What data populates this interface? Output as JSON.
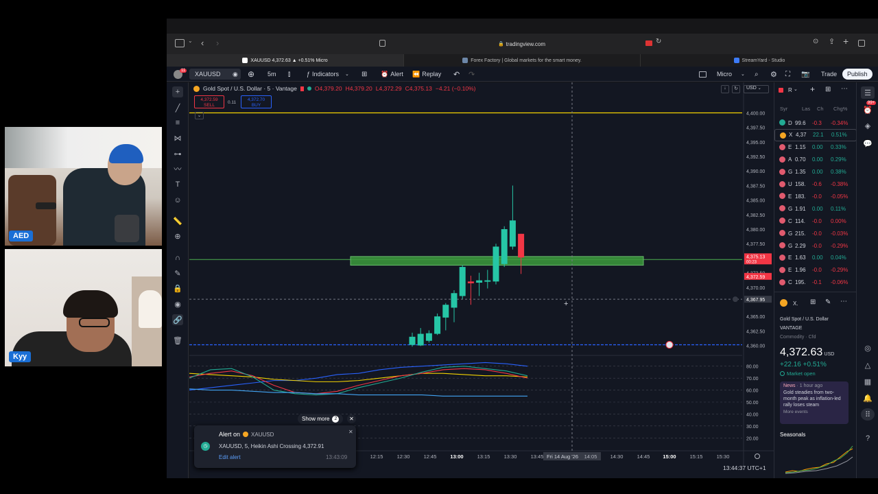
{
  "browser": {
    "url": "tradingview.com",
    "tabs": [
      {
        "label": "XAUUSD 4,372.63 ▲ +0.51% Micro",
        "active": true
      },
      {
        "label": "Forex Factory | Global markets for the smart money.",
        "active": false
      },
      {
        "label": "StreamYard - Studio",
        "active": false
      }
    ]
  },
  "toolbar": {
    "symbol": "XAUUSD",
    "notif_count": "11",
    "interval": "5m",
    "indicators": "Indicators",
    "alert": "Alert",
    "replay": "Replay",
    "layout_name": "Micro",
    "trade": "Trade",
    "publish": "Publish"
  },
  "legend": {
    "title": "Gold Spot / U.S. Dollar · 5 · Vantage",
    "o": "O4,379.20",
    "h": "H4,379.20",
    "l": "L4,372.29",
    "c": "C4,375.13",
    "chg": "−4.21 (−0.10%)",
    "sell_price": "4,372.59",
    "sell_label": "SELL",
    "spread": "0.11",
    "buy_price": "4,372.70",
    "buy_label": "BUY",
    "currency": "USD"
  },
  "chart_data": {
    "type": "candlestick",
    "symbol": "XAUUSD",
    "interval": "5",
    "price_ticks": [
      "4,400.00",
      "4,397.50",
      "4,395.00",
      "4,392.50",
      "4,390.00",
      "4,387.50",
      "4,385.00",
      "4,382.50",
      "4,380.00",
      "4,377.50",
      "4,375.00",
      "4,372.50",
      "4,370.00",
      "4,367.95",
      "4,365.00",
      "4,362.50",
      "4,360.00"
    ],
    "price_ylim": [
      4359,
      4401
    ],
    "time_ticks": [
      "12:15",
      "12:30",
      "12:45",
      "13:00",
      "13:15",
      "13:30",
      "13:45",
      "Fri 14 Aug '26",
      "14:05",
      "14:30",
      "14:45",
      "15:00",
      "15:15",
      "15:30"
    ],
    "candles": [
      {
        "o": 4360.1,
        "h": 4362.2,
        "l": 4359.8,
        "c": 4361.5,
        "dir": "up"
      },
      {
        "o": 4360.0,
        "h": 4363.0,
        "l": 4359.9,
        "c": 4362.0,
        "dir": "up"
      },
      {
        "o": 4360.8,
        "h": 4362.6,
        "l": 4360.5,
        "c": 4362.1,
        "dir": "up"
      },
      {
        "o": 4362.0,
        "h": 4365.5,
        "l": 4361.8,
        "c": 4365.0,
        "dir": "up"
      },
      {
        "o": 4364.8,
        "h": 4367.3,
        "l": 4362.6,
        "c": 4367.0,
        "dir": "up"
      },
      {
        "o": 4366.5,
        "h": 4369.5,
        "l": 4364.0,
        "c": 4369.0,
        "dir": "up"
      },
      {
        "o": 4368.5,
        "h": 4373.8,
        "l": 4368.0,
        "c": 4373.5,
        "dir": "up"
      },
      {
        "o": 4371.0,
        "h": 4372.0,
        "l": 4367.0,
        "c": 4370.7,
        "dir": "down"
      },
      {
        "o": 4370.8,
        "h": 4372.5,
        "l": 4368.5,
        "c": 4371.2,
        "dir": "up"
      },
      {
        "o": 4371.0,
        "h": 4373.0,
        "l": 4369.8,
        "c": 4371.2,
        "dir": "up"
      },
      {
        "o": 4371.0,
        "h": 4377.5,
        "l": 4370.5,
        "c": 4377.0,
        "dir": "up"
      },
      {
        "o": 4374.0,
        "h": 4380.5,
        "l": 4373.5,
        "c": 4380.0,
        "dir": "up"
      },
      {
        "o": 4377.0,
        "h": 4387.5,
        "l": 4376.5,
        "c": 4381.5,
        "dir": "up"
      },
      {
        "o": 4379.2,
        "h": 4379.2,
        "l": 4372.3,
        "c": 4375.13,
        "dir": "down"
      }
    ],
    "zone": {
      "top": 4375.3,
      "bottom": 4373.8
    },
    "levels": [
      {
        "name": "current price",
        "price": "4,375.13",
        "color": "#f23645",
        "countdown": "00:23"
      },
      {
        "name": "bid",
        "price": "4,372.59",
        "color": "#f23645"
      },
      {
        "name": "crosshair",
        "price": "4,367.95"
      },
      {
        "name": "alert",
        "price": "4,360.00",
        "color": "#2962ff"
      }
    ],
    "top_line": 4400.0,
    "oscillator": {
      "ticks": [
        "80.00",
        "70.00",
        "60.00",
        "50.00",
        "40.00",
        "30.00",
        "20.00"
      ],
      "ylim": [
        15,
        85
      ],
      "series": [
        {
          "color": "#2962ff",
          "values": [
            60,
            62,
            64,
            66,
            68,
            68,
            70,
            73,
            74,
            77,
            79,
            80,
            81,
            82,
            83,
            82,
            80
          ]
        },
        {
          "color": "#f5d400",
          "values": [
            74,
            73,
            72,
            71,
            69,
            68,
            67,
            67,
            68,
            70,
            72,
            74,
            74,
            73,
            72,
            72,
            71
          ]
        },
        {
          "color": "#f23645",
          "values": [
            71,
            74,
            76,
            72,
            64,
            58,
            57,
            59,
            64,
            68,
            72,
            74,
            77,
            78,
            77,
            74,
            70
          ]
        },
        {
          "color": "#22ab94",
          "values": [
            70,
            77,
            78,
            71,
            60,
            57,
            56,
            57,
            62,
            66,
            70,
            75,
            79,
            80,
            78,
            76,
            72
          ]
        },
        {
          "color": "#42a5f5",
          "values": [
            61,
            60,
            60,
            59,
            58,
            58,
            57,
            57,
            56,
            56,
            56,
            56,
            55,
            55,
            55,
            55,
            55
          ]
        }
      ]
    },
    "crosshair_time": "Fri 14 Aug '26",
    "crosshair_price": "4,367.95"
  },
  "watchlist": {
    "header": "R",
    "cols": [
      "Syr",
      "Las",
      "Ch",
      "Chg%"
    ],
    "rows": [
      {
        "sym": "D",
        "last": "99.6",
        "ch": "-0.3",
        "chgp": "-0.34%",
        "neg": true,
        "color": "#22ab94"
      },
      {
        "sym": "X",
        "last": "4,37",
        "ch": "22.1",
        "chgp": "0.51%",
        "neg": false,
        "color": "#f5a623"
      },
      {
        "sym": "E",
        "last": "1.15",
        "ch": "0.00",
        "chgp": "0.33%",
        "neg": false,
        "color": "#e05a6e"
      },
      {
        "sym": "A",
        "last": "0.70",
        "ch": "0.00",
        "chgp": "0.29%",
        "neg": false,
        "color": "#e05a6e"
      },
      {
        "sym": "G",
        "last": "1.35",
        "ch": "0.00",
        "chgp": "0.38%",
        "neg": false,
        "color": "#e05a6e"
      },
      {
        "sym": "U",
        "last": "158.",
        "ch": "-0.6",
        "chgp": "-0.38%",
        "neg": true,
        "color": "#e05a6e"
      },
      {
        "sym": "E",
        "last": "183.",
        "ch": "-0.0",
        "chgp": "-0.05%",
        "neg": true,
        "color": "#e05a6e"
      },
      {
        "sym": "G",
        "last": "1.91",
        "ch": "0.00",
        "chgp": "0.11%",
        "neg": false,
        "color": "#e05a6e"
      },
      {
        "sym": "C",
        "last": "114.",
        "ch": "-0.0",
        "chgp": "0.00%",
        "neg": true,
        "color": "#e05a6e"
      },
      {
        "sym": "G",
        "last": "215.",
        "ch": "-0.0",
        "chgp": "-0.03%",
        "neg": true,
        "color": "#e05a6e"
      },
      {
        "sym": "G",
        "last": "2.29",
        "ch": "-0.0",
        "chgp": "-0.29%",
        "neg": true,
        "color": "#e05a6e"
      },
      {
        "sym": "E",
        "last": "1.63",
        "ch": "0.00",
        "chgp": "0.04%",
        "neg": false,
        "color": "#e05a6e"
      },
      {
        "sym": "E",
        "last": "1.96",
        "ch": "-0.0",
        "chgp": "-0.29%",
        "neg": true,
        "color": "#e05a6e"
      },
      {
        "sym": "C",
        "last": "195.",
        "ch": "-0.1",
        "chgp": "-0.06%",
        "neg": true,
        "color": "#e05a6e"
      }
    ]
  },
  "details": {
    "short": "X.",
    "name": "Gold Spot / U.S. Dollar",
    "exchange": "VANTAGE",
    "category": "Commodity · Cfd",
    "price": "4,372.63",
    "currency": "USD",
    "change": "+22.16",
    "change_pct": "+0.51%",
    "status": "Market open",
    "news_tag": "News",
    "news_time": "· 1 hour ago",
    "news_text": "Gold steadies from two-month peak as inflation-led rally loses steam",
    "more_events": "More events",
    "seasonals": "Seasonals",
    "badge": "99+"
  },
  "toast": {
    "show_more": "Show more",
    "show_more_count": "2",
    "title": "Alert on",
    "symbol": "XAUUSD",
    "body": "XAUUSD, 5, Heikin Ashi Crossing 4,372.91",
    "link": "Edit alert",
    "time": "13:43:09"
  },
  "footer": {
    "clock": "13:44:37 UTC+1"
  },
  "webcams": [
    {
      "label": "AED"
    },
    {
      "label": "Kyy"
    }
  ]
}
